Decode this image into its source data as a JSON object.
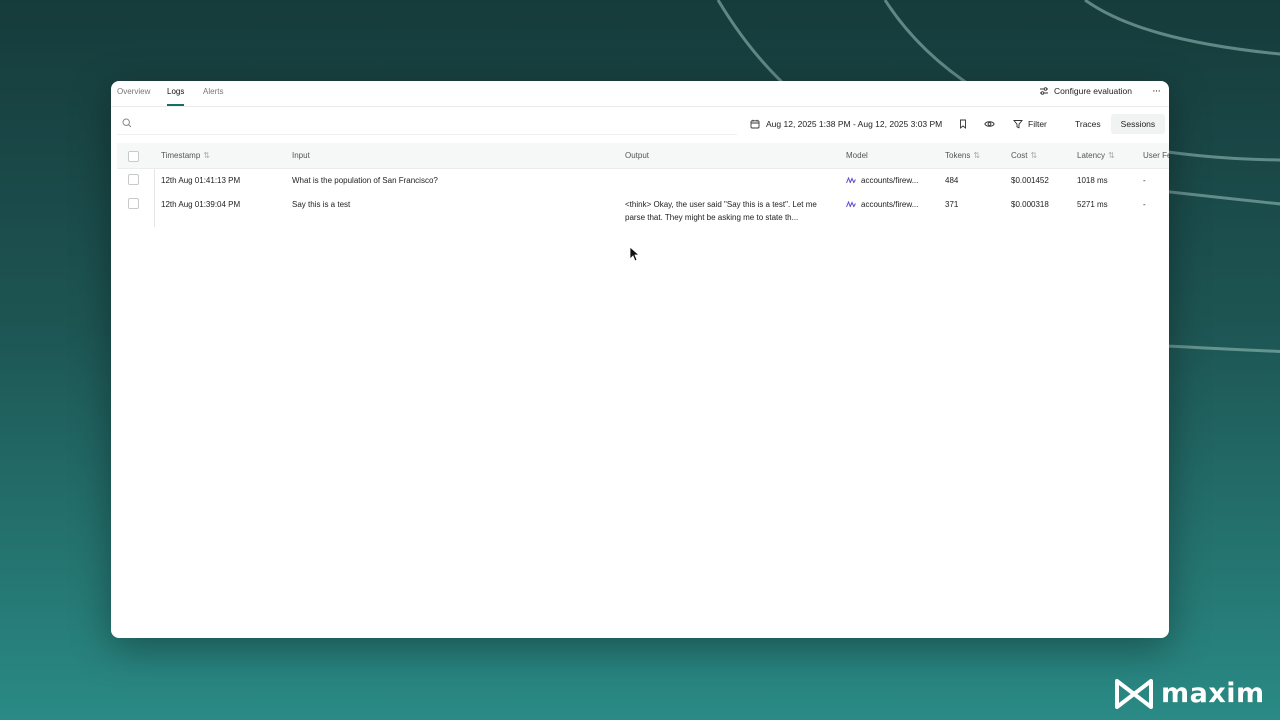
{
  "tabs": [
    {
      "label": "Overview",
      "active": false
    },
    {
      "label": "Logs",
      "active": true
    },
    {
      "label": "Alerts",
      "active": false
    }
  ],
  "header": {
    "configure_label": "Configure evaluation",
    "more_label": "···"
  },
  "toolbar": {
    "search_placeholder": "",
    "date_range": "Aug 12, 2025 1:38 PM - Aug 12, 2025 3:03 PM",
    "filter_label": "Filter",
    "view_options": [
      {
        "label": "Traces",
        "selected": false
      },
      {
        "label": "Sessions",
        "selected": true
      }
    ]
  },
  "table": {
    "columns": [
      "Timestamp",
      "Input",
      "Output",
      "Model",
      "Tokens",
      "Cost",
      "Latency",
      "User Fe"
    ],
    "rows": [
      {
        "timestamp": "12th Aug 01:41:13 PM",
        "input": "What is the population of San Francisco?",
        "output": "",
        "model": "accounts/firew...",
        "tokens": "484",
        "cost": "$0.001452",
        "latency": "1018 ms",
        "user_feedback": "-"
      },
      {
        "timestamp": "12th Aug 01:39:04 PM",
        "input": "Say this is a test",
        "output": "<think> Okay, the user said \"Say this is a test\". Let me parse that. They might be asking me to state th...",
        "model": "accounts/firew...",
        "tokens": "371",
        "cost": "$0.000318",
        "latency": "5271 ms",
        "user_feedback": "-"
      }
    ]
  },
  "brand": {
    "name": "maxim"
  },
  "colors": {
    "accent": "#1e6a66",
    "background_top": "#163b3b",
    "background_bottom": "#2a8a85"
  }
}
